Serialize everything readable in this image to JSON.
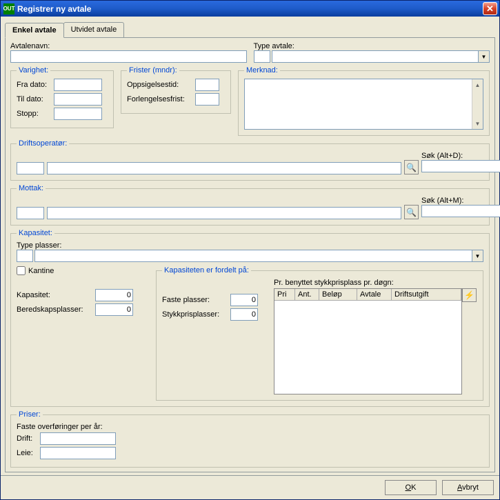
{
  "window": {
    "title": "Registrer ny avtale",
    "app_icon_text": "OUT"
  },
  "tabs": [
    {
      "label": "Enkel avtale",
      "active": true
    },
    {
      "label": "Utvidet avtale",
      "active": false
    }
  ],
  "fields": {
    "avtalenavn_label": "Avtalenavn:",
    "avtalenavn_value": "",
    "type_avtale_label": "Type avtale:",
    "type_avtale_code": "",
    "type_avtale_value": ""
  },
  "varighet": {
    "legend": "Varighet:",
    "fra_dato_label": "Fra dato:",
    "fra_dato_value": "",
    "til_dato_label": "Til dato:",
    "til_dato_value": "",
    "stopp_label": "Stopp:",
    "stopp_value": ""
  },
  "frister": {
    "legend": "Frister (mndr):",
    "oppsigelsestid_label": "Oppsigelsestid:",
    "oppsigelsestid_value": "",
    "forlengelsesfrist_label": "Forlengelsesfrist:",
    "forlengelsesfrist_value": ""
  },
  "merknad": {
    "legend": "Merknad:",
    "value": ""
  },
  "driftsoperator": {
    "legend": "Driftsoperatør:",
    "code": "",
    "name": "",
    "sok_label": "Søk (Alt+D):",
    "sok_value": ""
  },
  "mottak": {
    "legend": "Mottak:",
    "code": "",
    "name": "",
    "sok_label": "Søk (Alt+M):",
    "sok_value": ""
  },
  "kapasitet": {
    "legend": "Kapasitet:",
    "type_plasser_label": "Type plasser:",
    "type_plasser_code": "",
    "type_plasser_value": "",
    "kantine_label": "Kantine",
    "kantine_checked": false,
    "kapasitet_label": "Kapasitet:",
    "kapasitet_value": "0",
    "beredskap_label": "Beredskapsplasser:",
    "beredskap_value": "0",
    "fordelt_legend": "Kapasiteten er fordelt på:",
    "faste_plasser_label": "Faste plasser:",
    "faste_plasser_value": "0",
    "stykkpris_label": "Stykkprisplasser:",
    "stykkpris_value": "0",
    "table_caption": "Pr. benyttet stykkprisplass pr. døgn:",
    "table_headers": [
      "Pri",
      "Ant.",
      "Beløp",
      "Avtale",
      "Driftsutgift"
    ]
  },
  "priser": {
    "legend": "Priser:",
    "sublabel": "Faste overføringer per år:",
    "drift_label": "Drift:",
    "drift_value": "",
    "leie_label": "Leie:",
    "leie_value": ""
  },
  "buttons": {
    "ok": "OK",
    "avbryt": "Avbryt"
  },
  "icons": {
    "search": "🔍",
    "binoculars": "🔭",
    "lightning": "⚡"
  }
}
